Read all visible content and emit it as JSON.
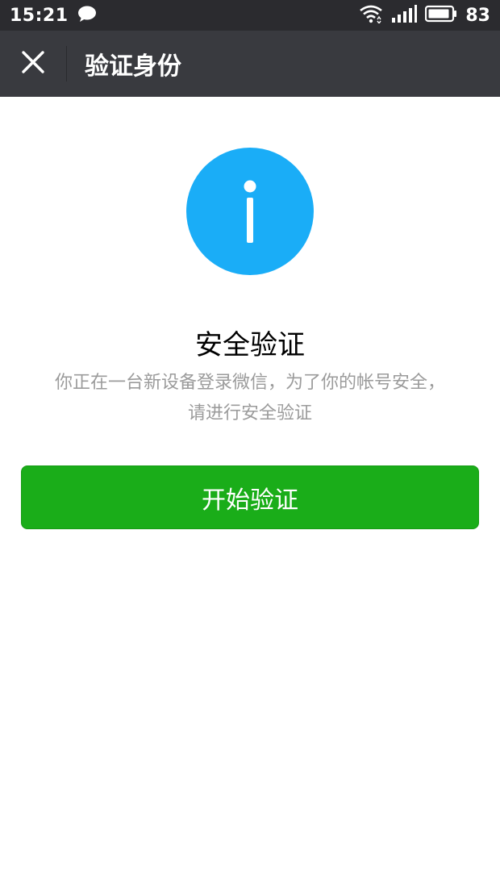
{
  "status_bar": {
    "time": "15:21",
    "battery_percent": "83",
    "icons": [
      "chat-bubble-icon",
      "wifi-icon",
      "signal-icon",
      "battery-icon"
    ]
  },
  "nav": {
    "title": "验证身份",
    "close_icon": "close-icon",
    "background": "#393a3f"
  },
  "main": {
    "icon": "info-icon",
    "icon_color": "#1aadf7",
    "heading": "安全验证",
    "description_line1": "你正在一台新设备登录微信，为了你的帐号安全，",
    "description_line2": "请进行安全验证",
    "button_label": "开始验证",
    "button_color": "#1aad19"
  }
}
